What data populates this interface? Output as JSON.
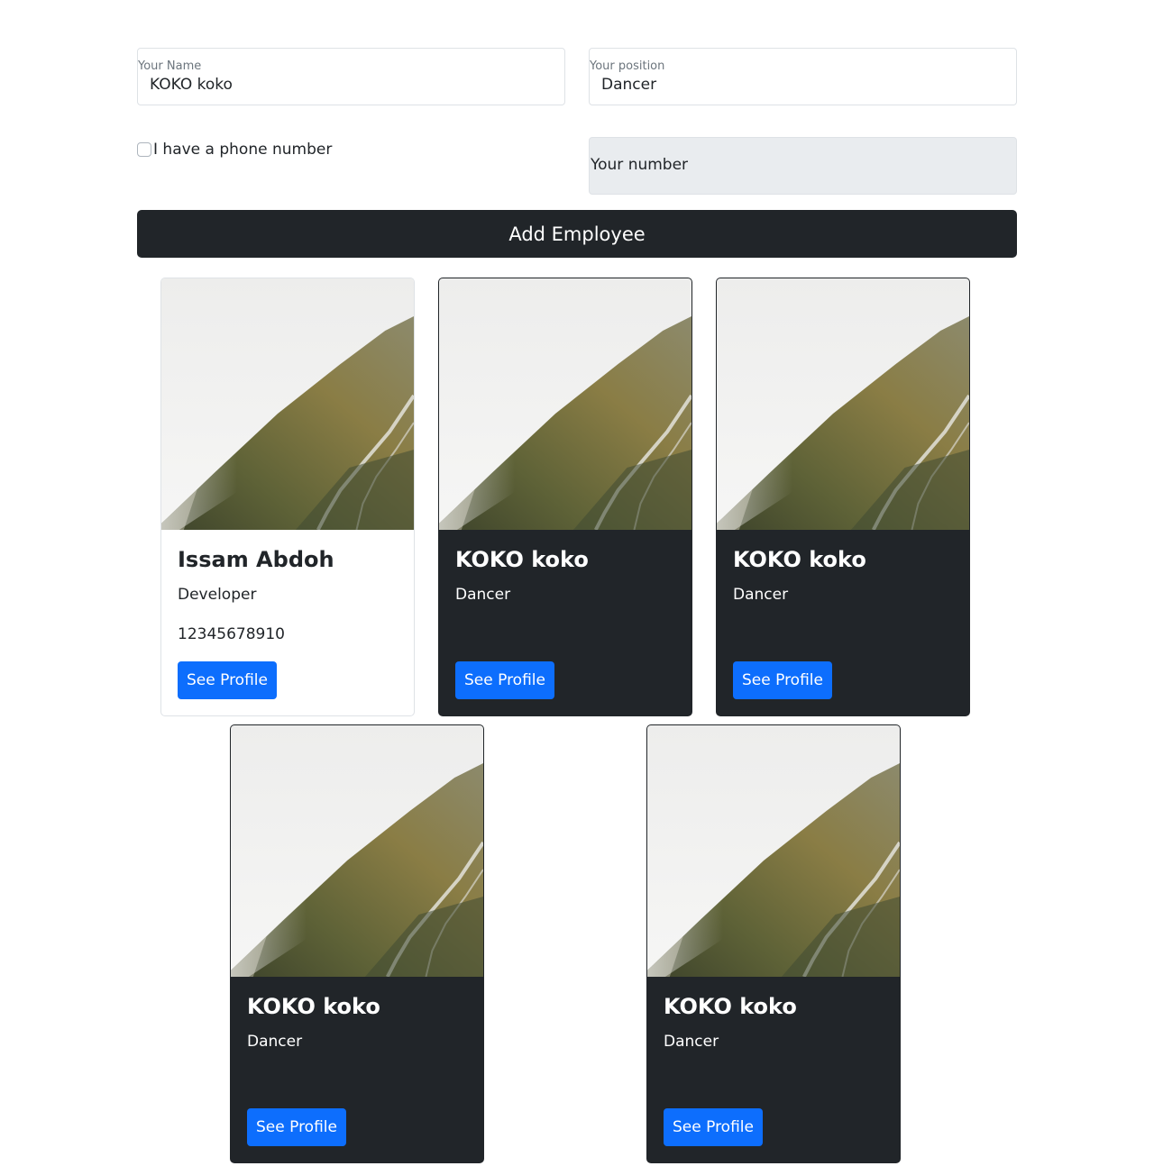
{
  "form": {
    "name_field": {
      "label": "Your Name",
      "value": "KOKO koko"
    },
    "position_field": {
      "label": "Your position",
      "value": "Dancer"
    },
    "phone_checkbox": {
      "label": "I have a phone number",
      "checked": false
    },
    "number_field": {
      "placeholder": "Your number",
      "disabled": true
    },
    "add_button": "Add Employee"
  },
  "cards": [
    {
      "name": "Issam Abdoh",
      "position": "Developer",
      "phone": "12345678910",
      "button": "See Profile",
      "theme": "light"
    },
    {
      "name": "KOKO koko",
      "position": "Dancer",
      "phone": "",
      "button": "See Profile",
      "theme": "dark"
    },
    {
      "name": "KOKO koko",
      "position": "Dancer",
      "phone": "",
      "button": "See Profile",
      "theme": "dark"
    },
    {
      "name": "KOKO koko",
      "position": "Dancer",
      "phone": "",
      "button": "See Profile",
      "theme": "dark"
    },
    {
      "name": "KOKO koko",
      "position": "Dancer",
      "phone": "",
      "button": "See Profile",
      "theme": "dark"
    }
  ],
  "colors": {
    "dark": "#212529",
    "primary": "#0d6efd",
    "border": "#dee2e6",
    "disabled_bg": "#e9ecef"
  }
}
